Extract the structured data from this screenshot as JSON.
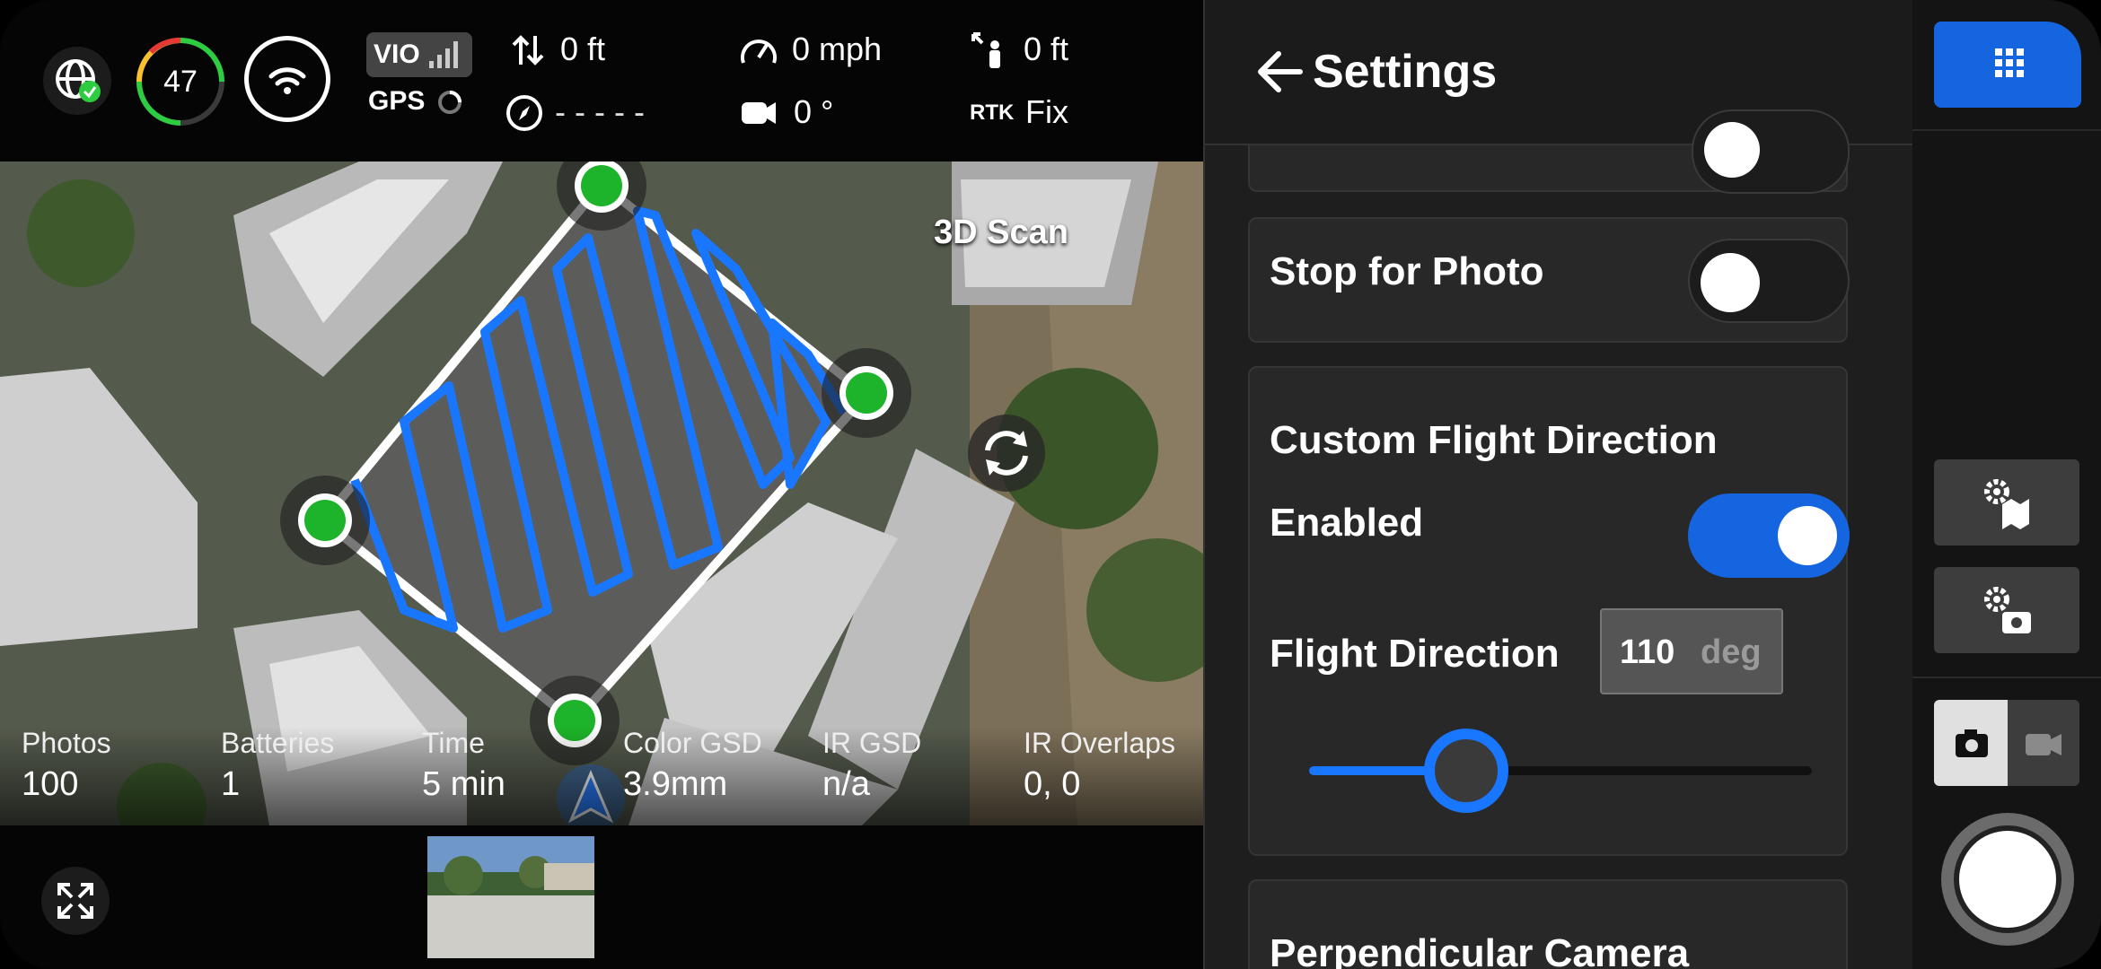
{
  "status": {
    "battery_percent": "47",
    "vio_label": "VIO",
    "gps_label": "GPS",
    "altitude": "0 ft",
    "heading": "- - - - -",
    "speed": "0 mph",
    "gimbal": "0 °",
    "distance": "0 ft",
    "rtk_label": "RTK",
    "rtk_status": "Fix",
    "colors": {
      "battery_ring": "#2ecc40",
      "battery_low": "#e53935",
      "battery_mid": "#fbc02d"
    }
  },
  "map": {
    "scan_label": "3D Scan",
    "waypoint_color": "#1db32a",
    "path_color": "#1976ff"
  },
  "stats": [
    {
      "label": "Photos",
      "value": "100"
    },
    {
      "label": "Batteries",
      "value": "1"
    },
    {
      "label": "Time",
      "value": "5 min"
    },
    {
      "label": "Color GSD",
      "value": "3.9mm"
    },
    {
      "label": "IR GSD",
      "value": "n/a"
    },
    {
      "label": "IR Overlaps",
      "value": "0, 0"
    }
  ],
  "settings": {
    "title": "Settings",
    "stop_for_photo": {
      "label": "Stop for Photo",
      "enabled": false
    },
    "custom_flight_direction": {
      "title": "Custom Flight Direction",
      "enabled_label": "Enabled",
      "enabled": true,
      "direction_label": "Flight Direction",
      "direction_value": "110",
      "direction_unit": "deg",
      "slider_fraction": 0.31
    },
    "next_section_title": "Perpendicular Camera",
    "accent": "#1565e0"
  },
  "right_rail": {
    "camera_mode": "photo"
  }
}
